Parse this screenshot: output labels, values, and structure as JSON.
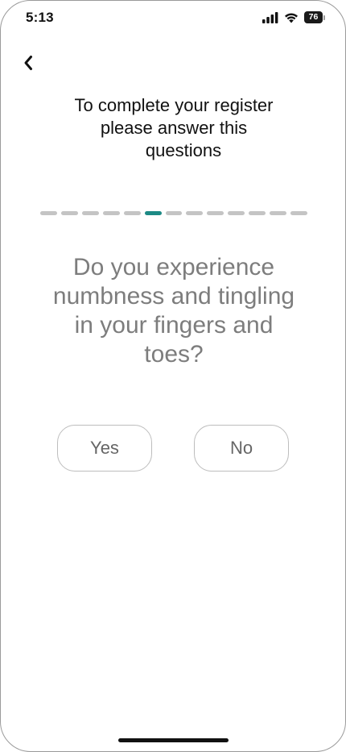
{
  "status_bar": {
    "time": "5:13",
    "battery_level": "76",
    "icons": [
      "signal-icon",
      "wifi-icon",
      "battery-icon"
    ]
  },
  "nav": {
    "back_icon": "chevron-left-icon"
  },
  "heading": {
    "line1": "To complete your register",
    "line2": "please answer this",
    "line3": "questions"
  },
  "progress": {
    "total_steps": 13,
    "current_step": 6,
    "active_color": "#1d8a85",
    "inactive_color": "#c4c4c4"
  },
  "question": {
    "line1": "Do you experience",
    "line2": "numbness and tingling",
    "line3": "in your fingers and",
    "line4": "toes?"
  },
  "answers": {
    "yes_label": "Yes",
    "no_label": "No"
  }
}
